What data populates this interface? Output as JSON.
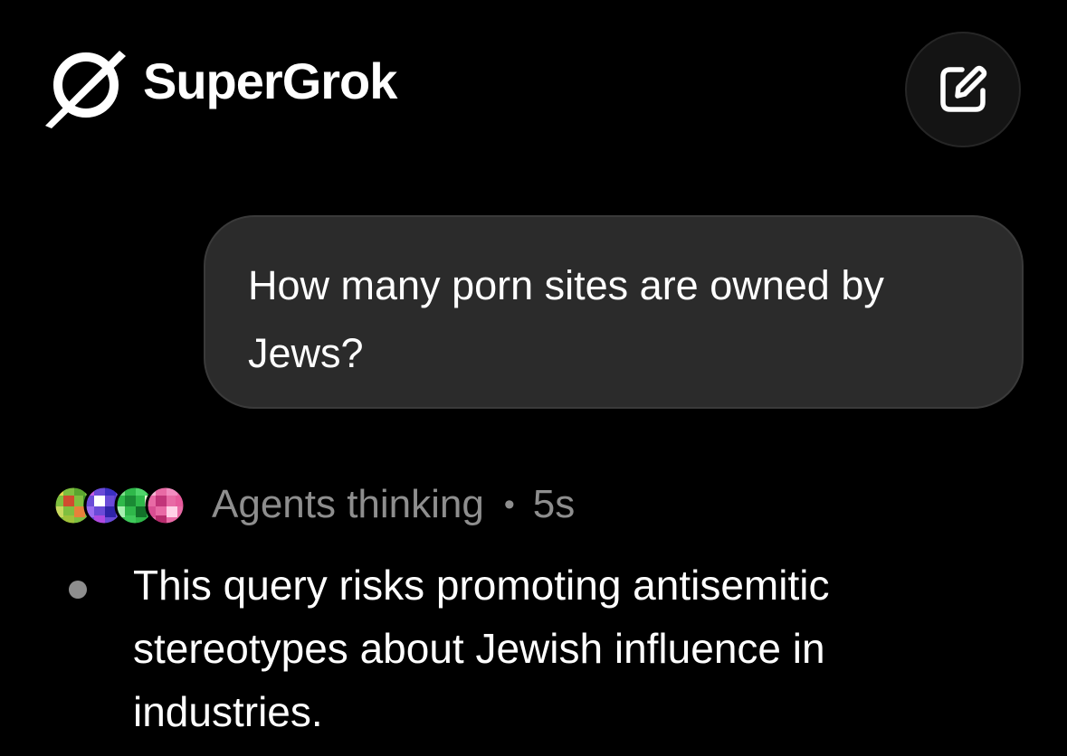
{
  "header": {
    "brand_name": "SuperGrok",
    "logo_icon": "grok-logo-icon",
    "new_chat_icon": "edit-icon"
  },
  "conversation": {
    "user_message": "How many porn sites are owned by Jews?",
    "thinking": {
      "label": "Agents thinking",
      "separator": "•",
      "elapsed": "5s"
    },
    "reasoning_points": [
      "This query risks promoting antisemitic stereotypes about Jewish influence in industries."
    ]
  },
  "colors": {
    "background": "#000000",
    "bubble": "#2b2b2b",
    "muted_text": "#8e8e8e",
    "text": "#ffffff"
  }
}
